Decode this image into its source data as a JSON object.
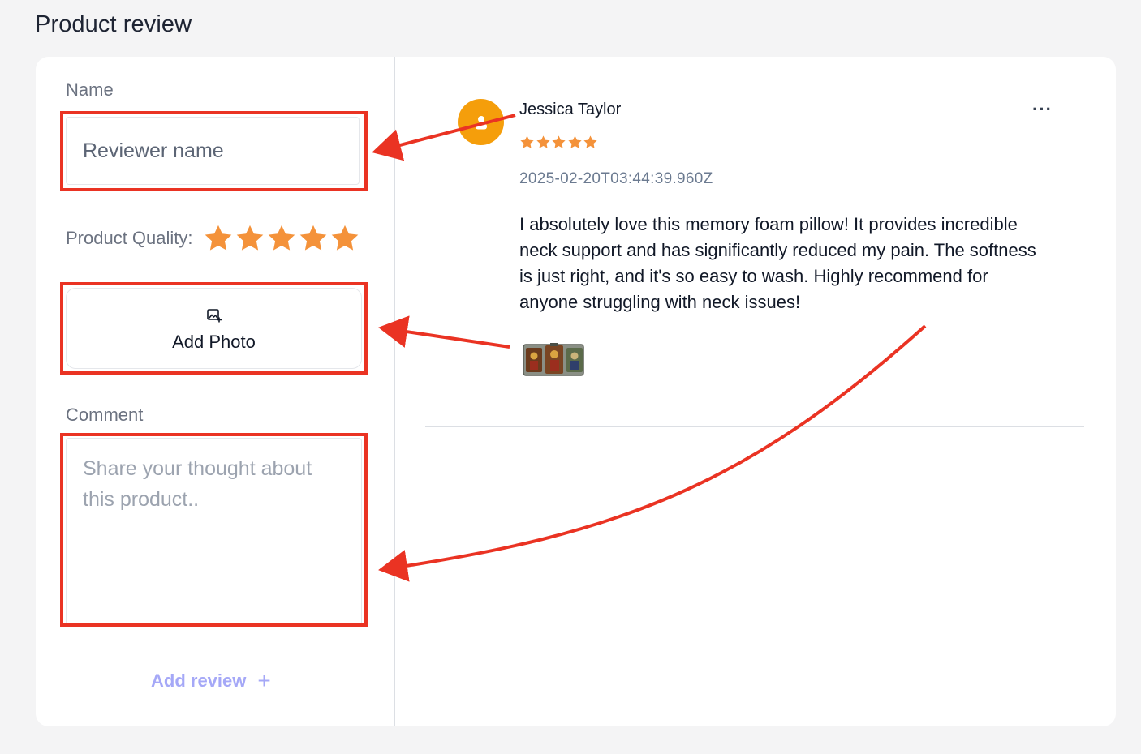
{
  "page": {
    "title": "Product review"
  },
  "form": {
    "name_label": "Name",
    "name_value": "Reviewer name",
    "quality_label": "Product Quality:",
    "quality_rating": 5,
    "add_photo_label": "Add Photo",
    "comment_label": "Comment",
    "comment_placeholder": "Share your thought about this product..",
    "add_review_label": "Add review",
    "add_review_icon": "plus-icon"
  },
  "review": {
    "reviewer_name": "Jessica Taylor",
    "avatar_icon": "user-icon",
    "rating": 5,
    "date": "2025-02-20T03:44:39.960Z",
    "text": "I absolutely love this memory foam pillow! It provides incredible neck support and has significantly reduced my pain. The softness is just right, and it's so easy to wash. Highly recommend for anyone struggling with neck issues!",
    "more_icon": "more-horizontal-icon",
    "photo_icon": "image-thumbnail"
  },
  "colors": {
    "star": "#f4923a",
    "avatar": "#f59e0b",
    "accent": "#a5a8f7",
    "annotation": "#ea3323"
  }
}
